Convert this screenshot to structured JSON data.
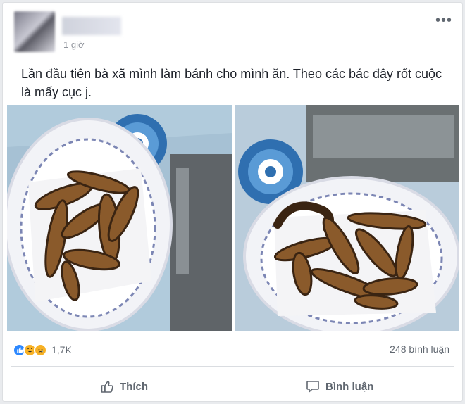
{
  "post": {
    "time": "1 giờ",
    "text": "Lần đầu tiên bà xã mình làm bánh cho mình ăn. Theo các bác đây rốt cuộc là mấy cục j.",
    "more_icon": "more-dots-icon"
  },
  "reactions": {
    "icons": [
      "like-icon",
      "haha-icon",
      "sad-icon"
    ],
    "count": "1,7K"
  },
  "comments": {
    "count_text": "248 bình luận"
  },
  "actions": {
    "like_label": "Thích",
    "comment_label": "Bình luận"
  },
  "colors": {
    "like_blue": "#2d88ff",
    "reaction_yellow": "#f7b125",
    "secondary_text": "#606770"
  }
}
